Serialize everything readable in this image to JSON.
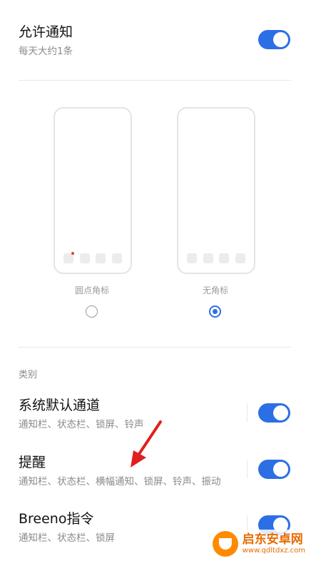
{
  "allow": {
    "title": "允许通知",
    "subtitle": "每天大约1条"
  },
  "badge_options": [
    {
      "caption": "圆点角标",
      "selected": false
    },
    {
      "caption": "无角标",
      "selected": true
    }
  ],
  "category_header": "类别",
  "categories": [
    {
      "title": "系统默认通道",
      "subtitle": "通知栏、状态栏、锁屏、铃声"
    },
    {
      "title": "提醒",
      "subtitle": "通知栏、状态栏、横幅通知、锁屏、铃声、振动"
    },
    {
      "title": "Breeno指令",
      "subtitle": "通知栏、状态栏、锁屏"
    }
  ],
  "watermark": {
    "name": "启东安卓网",
    "url": "www.qdltdxz.com"
  },
  "colors": {
    "accent": "#2c6fe5",
    "badge_dot": "#e53935",
    "annotation_arrow": "#e02020"
  }
}
